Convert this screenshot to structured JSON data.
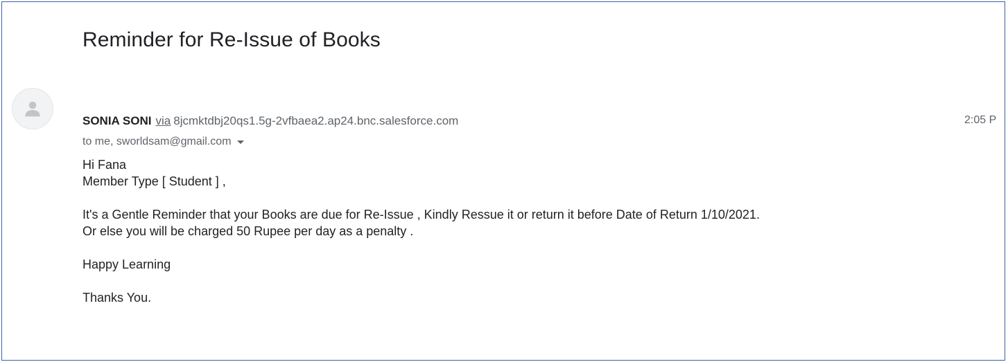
{
  "email": {
    "subject": "Reminder for Re-Issue of Books",
    "sender_name": "SONIA SONI",
    "via_label": "via",
    "sender_domain": "8jcmktdbj20qs1.5g-2vfbaea2.ap24.bnc.salesforce.com",
    "time": "2:05 P",
    "recipients": "to me, sworldsam@gmail.com",
    "body": {
      "greeting": "Hi  Fana",
      "member_type": " Member Type [ Student ] ,",
      "reminder": "It's a Gentle Reminder that your Books are due for Re-Issue , Kindly Ressue it or return it before Date of Return  1/10/2021.",
      "penalty": "Or else you will be charged 50 Rupee per day as a penalty .",
      "closing": "Happy Learning",
      "signoff": "Thanks You."
    }
  },
  "icons": {
    "avatar": "person-icon",
    "recipients_toggle": "chevron-down-icon"
  },
  "colors": {
    "frame_border": "#3b5ea8",
    "avatar_bg": "#f1f3f4",
    "avatar_glyph": "#c1c4c8",
    "meta_text": "#5f6368"
  }
}
